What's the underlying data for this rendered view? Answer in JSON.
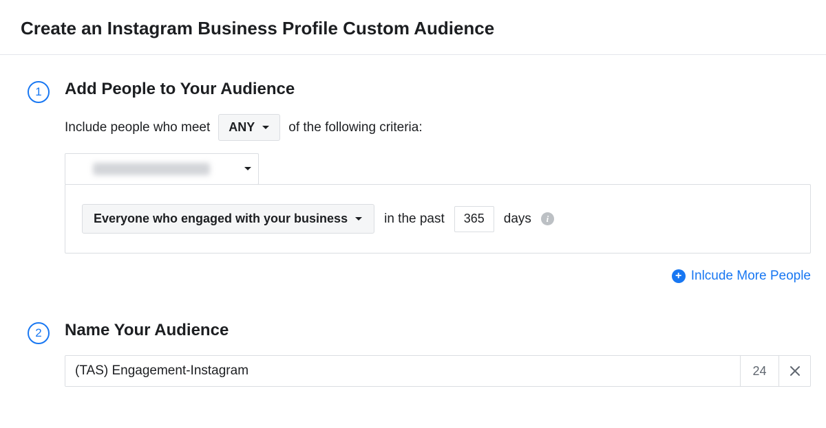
{
  "header": {
    "title": "Create an Instagram Business Profile Custom Audience"
  },
  "step1": {
    "number": "1",
    "title": "Add People to Your Audience",
    "include_prefix": "Include people who meet",
    "match_mode": "ANY",
    "include_suffix": "of the following criteria:",
    "engagement_type": "Everyone who engaged with your business",
    "past_prefix": "in the past",
    "days_value": "365",
    "days_suffix": "days",
    "include_more_label": "Inlcude More People"
  },
  "step2": {
    "number": "2",
    "title": "Name Your Audience",
    "name_value": "(TAS) Engagement-Instagram",
    "remaining_chars": "24"
  }
}
